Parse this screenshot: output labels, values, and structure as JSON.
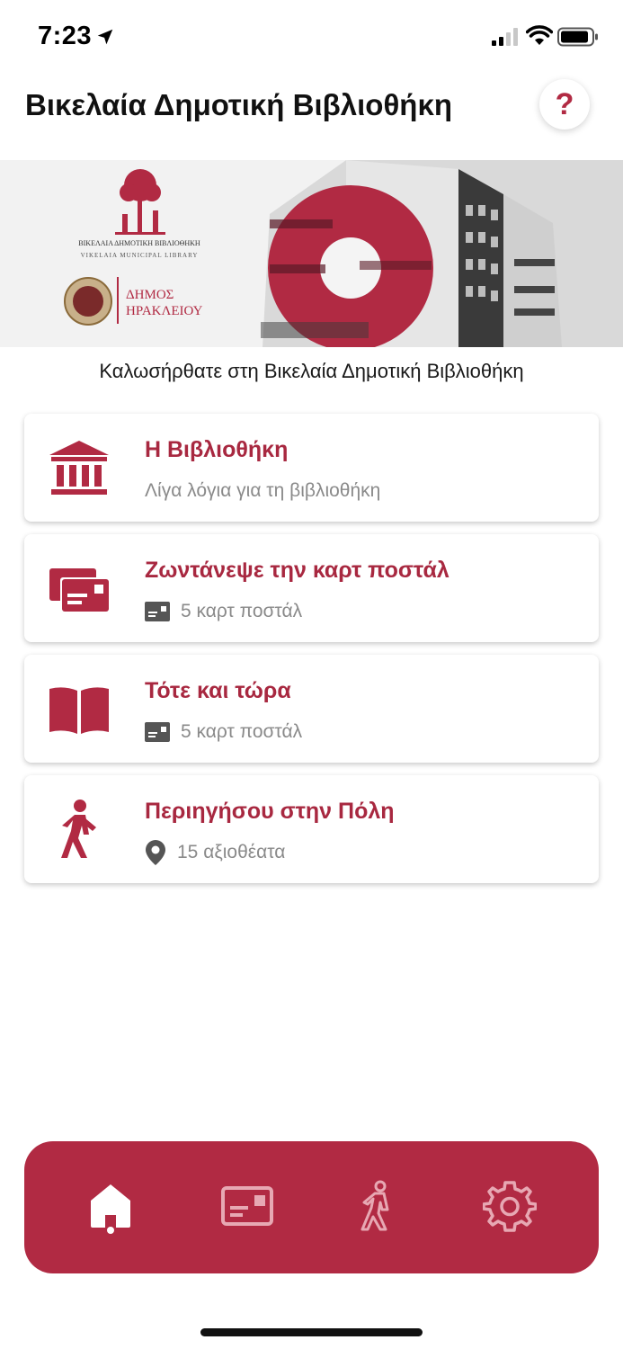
{
  "status_bar": {
    "time": "7:23"
  },
  "header": {
    "title": "Βικελαία Δημοτική Βιβλιοθήκη",
    "help_label": "?"
  },
  "banner": {
    "logo_line1": "ΒΙΚΕΛΑΙΑ ΔΗΜΟΤΙΚΗ ΒΙΒΛΙΟΘΗΚΗ",
    "logo_line2": "VIKELAIA MUNICIPAL LIBRARY",
    "municipality_line1": "ΔΗΜΟΣ",
    "municipality_line2": "ΗΡΑΚΛΕΙΟΥ"
  },
  "welcome_text": "Καλωσήρθατε στη Βικελαία Δημοτική Βιβλιοθήκη",
  "menu": [
    {
      "icon": "library-icon",
      "title": "Η Βιβλιοθήκη",
      "subtitle": "Λίγα λόγια για τη βιβλιοθήκη"
    },
    {
      "icon": "postcards-icon",
      "title": "Ζωντάνεψε την καρτ ποστάλ",
      "meta_icon": "postcard-icon",
      "meta": "5 καρτ ποστάλ"
    },
    {
      "icon": "book-icon",
      "title": "Τότε και τώρα",
      "meta_icon": "postcard-icon",
      "meta": "5 καρτ ποστάλ"
    },
    {
      "icon": "walking-icon",
      "title": "Περιηγήσου στην Πόλη",
      "meta_icon": "location-pin-icon",
      "meta": "15 αξιοθέατα"
    }
  ],
  "bottom_nav": {
    "items": [
      {
        "icon": "home-icon",
        "active": true
      },
      {
        "icon": "postcard-icon",
        "active": false
      },
      {
        "icon": "walking-icon",
        "active": false
      },
      {
        "icon": "settings-icon",
        "active": false
      }
    ]
  },
  "colors": {
    "accent": "#b12a43",
    "title_text": "#a82840",
    "muted_text": "#8a8a8a"
  }
}
